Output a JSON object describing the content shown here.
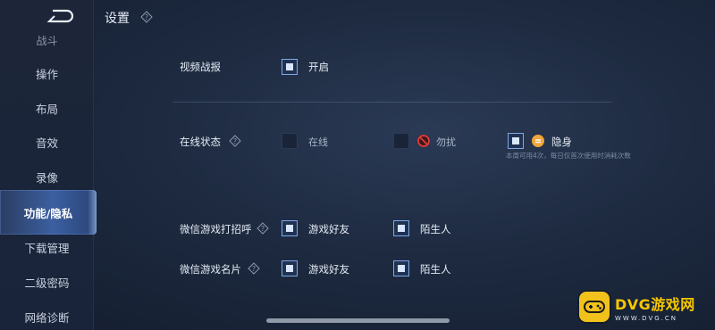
{
  "header": {
    "title": "设置"
  },
  "sidebar": {
    "items": [
      {
        "label": "战斗",
        "partial": true
      },
      {
        "label": "操作"
      },
      {
        "label": "布局"
      },
      {
        "label": "音效"
      },
      {
        "label": "录像"
      },
      {
        "label": "功能/隐私",
        "active": true
      },
      {
        "label": "下载管理"
      },
      {
        "label": "二级密码"
      },
      {
        "label": "网络诊断"
      }
    ]
  },
  "settings": {
    "video_report": {
      "label": "视频战报",
      "option": "开启",
      "checked": true
    },
    "online_status": {
      "label": "在线状态",
      "options": [
        {
          "label": "在线",
          "checked": false
        },
        {
          "label": "勿扰",
          "checked": false,
          "icon": "no-entry-icon"
        },
        {
          "label": "隐身",
          "checked": true,
          "icon": "invisible-face-icon"
        }
      ],
      "hint": "本周可用4次，每日仅首次使用时消耗次数"
    },
    "wechat_greet": {
      "label": "微信游戏打招呼",
      "options": [
        {
          "label": "游戏好友",
          "checked": true
        },
        {
          "label": "陌生人",
          "checked": true
        }
      ]
    },
    "wechat_card": {
      "label": "微信游戏名片",
      "options": [
        {
          "label": "游戏好友",
          "checked": true
        },
        {
          "label": "陌生人",
          "checked": true
        }
      ]
    }
  },
  "watermark": {
    "main": "DVG游戏网",
    "sub": "WWW.DVG.CN"
  },
  "colors": {
    "accent": "#7fa8e6",
    "active_tab": "#3b5fa0",
    "watermark": "#f1c21b"
  }
}
